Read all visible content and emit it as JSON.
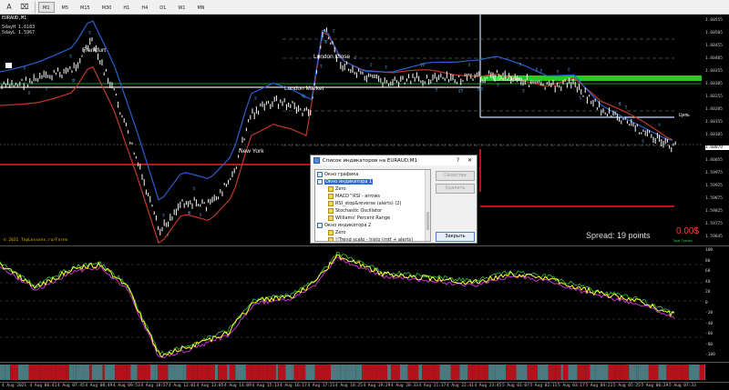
{
  "toolbar": {
    "tool1": "A",
    "tool2": "⌧",
    "timeframes": [
      "M1",
      "M5",
      "M15",
      "M30",
      "H1",
      "H4",
      "D1",
      "W1",
      "MN"
    ],
    "active_tf": "M1"
  },
  "chart": {
    "symbol": "EURAUD,M1",
    "info_line1": "5dayH 1.6183",
    "info_line2": "5dayL 1.5967",
    "sessions": [
      "Frankfurt",
      "London Close",
      "London Market",
      "New York",
      "Lond Open",
      "Цепь"
    ],
    "watermark": "© 2021 TopLessons.ru/Forex",
    "spread": "Spread: 19 points",
    "pnl": "0.00$",
    "pnl_sub": "Total Trades",
    "price_labels": [
      "1.60555",
      "1.60505",
      "1.60455",
      "1.60405",
      "1.60355",
      "1.60305",
      "1.60255",
      "1.60205",
      "1.60155",
      "1.60105",
      "1.60079",
      "1.60055",
      "1.59975",
      "1.59925",
      "1.59875",
      "1.59825",
      "1.59775",
      "1.59645"
    ],
    "colors": {
      "bg": "#000000",
      "candle": "#ffffff",
      "red_line": "#ff1a1a",
      "green_band": "#22cc22",
      "ma_red": "#c0392b",
      "ma_blue": "#2a5fd0"
    }
  },
  "oscillator": {
    "labels": [
      "100",
      "80",
      "60",
      "40",
      "20",
      "0",
      "-20",
      "-40",
      "-60",
      "-80",
      "-100"
    ],
    "colors": {
      "fast": "#ffff33",
      "slow": "#cc33cc",
      "alt": "#33cc33"
    }
  },
  "time_axis": [
    "4 Aug 2021",
    "4 Aug 06:41",
    "4 Aug 07:45",
    "4 Aug 08:49",
    "4 Aug 09:53",
    "4 Aug 10:57",
    "4 Aug 12:01",
    "4 Aug 13:05",
    "4 Aug 14:09",
    "4 Aug 15:13",
    "4 Aug 16:17",
    "4 Aug 17:21",
    "4 Aug 18:25",
    "4 Aug 19:29",
    "4 Aug 20:33",
    "4 Aug 21:37",
    "4 Aug 22:41",
    "4 Aug 23:45",
    "5 Aug 01:07",
    "5 Aug 02:11",
    "5 Aug 03:17",
    "5 Aug 04:21",
    "5 Aug 05:25",
    "5 Aug 06:29",
    "5 Aug 07:33"
  ],
  "dialog": {
    "title": "Список индикаторов на EURAUD,M1",
    "help": "?",
    "close": "✕",
    "tree": [
      {
        "label": "Окно графика",
        "kind": "win",
        "selected": false
      },
      {
        "label": "Окно индикатора 1",
        "kind": "win",
        "selected": true
      },
      {
        "label": "Zero",
        "kind": "ind",
        "selected": false
      },
      {
        "label": "MACD^RSI - arrows",
        "kind": "ind",
        "selected": false
      },
      {
        "label": "RSI_stop&reverse (alerts) (2)",
        "kind": "ind",
        "selected": false
      },
      {
        "label": "Stochastic Oscillator",
        "kind": "ind",
        "selected": false
      },
      {
        "label": "Williams' Percent Range",
        "kind": "ind",
        "selected": false
      },
      {
        "label": "Окно индикатора 2",
        "kind": "win",
        "selected": false
      },
      {
        "label": "Zero",
        "kind": "ind",
        "selected": false
      },
      {
        "label": "!!Trend scalp - histo (mtf + alerts)",
        "kind": "ind",
        "selected": false
      }
    ],
    "btn_properties": "Свойства",
    "btn_delete": "Удалить",
    "btn_close": "Закрыть"
  }
}
